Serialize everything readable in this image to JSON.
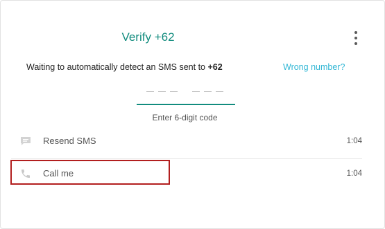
{
  "header": {
    "title": "Verify +62"
  },
  "message": {
    "text": "Waiting to automatically detect an SMS sent to ",
    "number": "+62",
    "wrong_number_link": "Wrong number?"
  },
  "code_field": {
    "label": "Enter 6-digit code"
  },
  "options": [
    {
      "label": "Resend SMS",
      "time": "1:04",
      "icon": "message-icon"
    },
    {
      "label": "Call me",
      "time": "1:04",
      "icon": "phone-icon"
    }
  ],
  "colors": {
    "accent": "#128c7e",
    "link": "#32b7d5",
    "highlight": "#b21e1e"
  }
}
